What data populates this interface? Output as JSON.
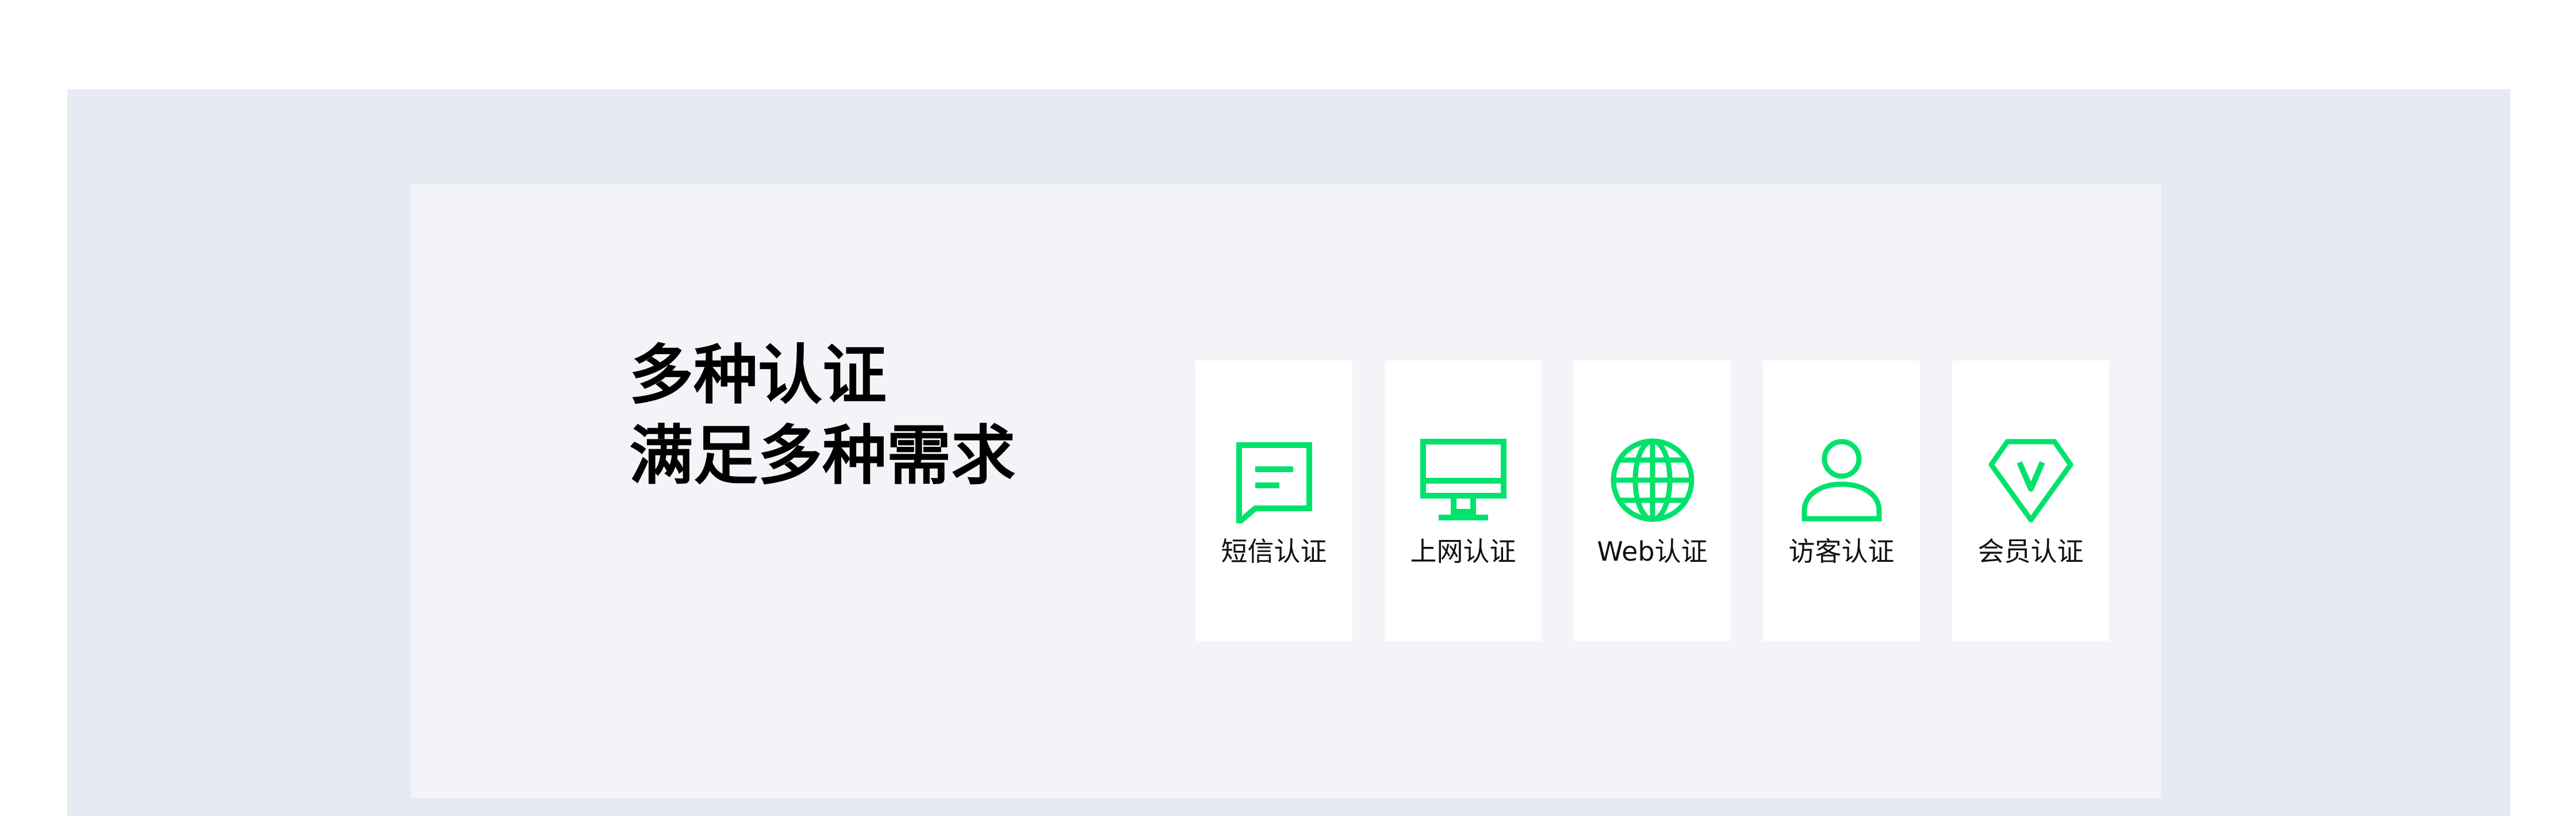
{
  "headline": {
    "line1": "多种认证",
    "line2": "满足多种需求"
  },
  "colors": {
    "accent": "#00e26b",
    "outer_background": "#e6eaf3",
    "panel_background": "#f2f4f8",
    "card_background": "#ffffff",
    "headline_text": "#000000"
  },
  "auth_methods": [
    {
      "label": "短信认证",
      "icon": "message-icon"
    },
    {
      "label": "上网认证",
      "icon": "monitor-icon"
    },
    {
      "label": "Web认证",
      "icon": "globe-icon"
    },
    {
      "label": "访客认证",
      "icon": "user-icon"
    },
    {
      "label": "会员认证",
      "icon": "vip-diamond-icon"
    }
  ]
}
